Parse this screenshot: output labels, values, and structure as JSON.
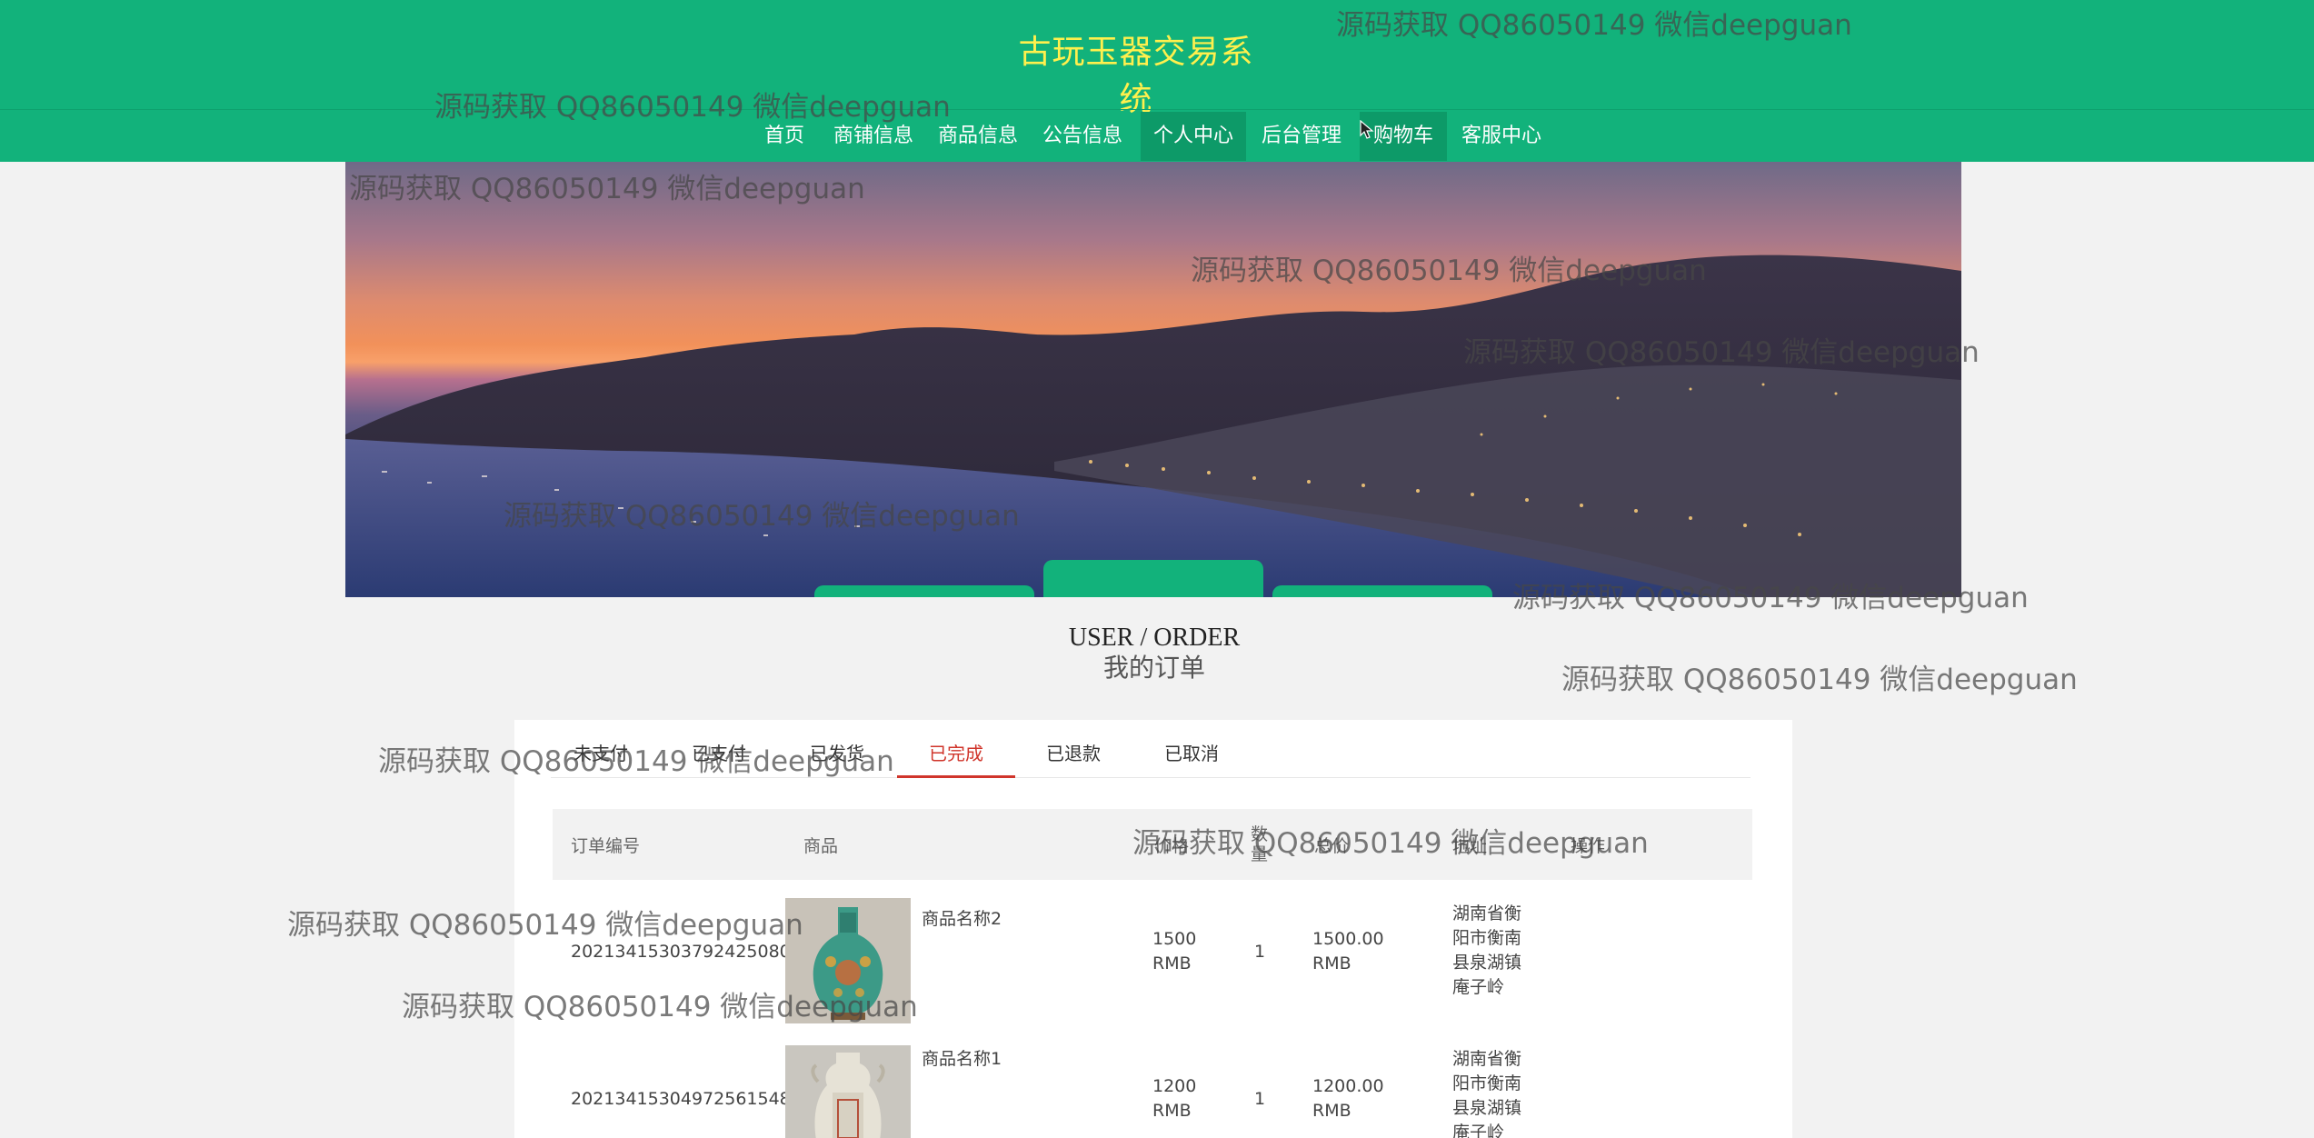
{
  "site": {
    "title": "古玩玉器交易系统"
  },
  "nav": {
    "items": [
      {
        "label": "首页"
      },
      {
        "label": "商铺信息"
      },
      {
        "label": "商品信息"
      },
      {
        "label": "公告信息"
      },
      {
        "label": "个人中心"
      },
      {
        "label": "后台管理"
      },
      {
        "label": "购物车"
      },
      {
        "label": "客服中心"
      }
    ],
    "active": "个人中心"
  },
  "section": {
    "title_en": "USER / ORDER",
    "title_cn": "我的订单"
  },
  "order_tabs": {
    "items": [
      {
        "label": "未支付"
      },
      {
        "label": "已支付"
      },
      {
        "label": "已发货"
      },
      {
        "label": "已完成"
      },
      {
        "label": "已退款"
      },
      {
        "label": "已取消"
      }
    ],
    "active": "已完成"
  },
  "table": {
    "headers": {
      "order_no": "订单编号",
      "product": "商品",
      "price": "价格",
      "qty": "数量",
      "total": "总价",
      "address": "地址",
      "action": "操作"
    },
    "rows": [
      {
        "order_no": "20213415303792425080",
        "product_name": "商品名称2",
        "price": "1500 RMB",
        "qty": "1",
        "total": "1500.00 RMB",
        "address": "湖南省衡阳市衡南县泉湖镇庵子岭"
      },
      {
        "order_no": "20213415304972561548",
        "product_name": "商品名称1",
        "price": "1200 RMB",
        "qty": "1",
        "total": "1200.00 RMB",
        "address": "湖南省衡阳市衡南县泉湖镇庵子岭"
      }
    ]
  },
  "watermark": {
    "text": "源码获取 QQ86050149 微信deepguan"
  },
  "colors": {
    "brand": "#12b27b",
    "title_yellow": "#fff04d",
    "active_red": "#d0352b"
  }
}
